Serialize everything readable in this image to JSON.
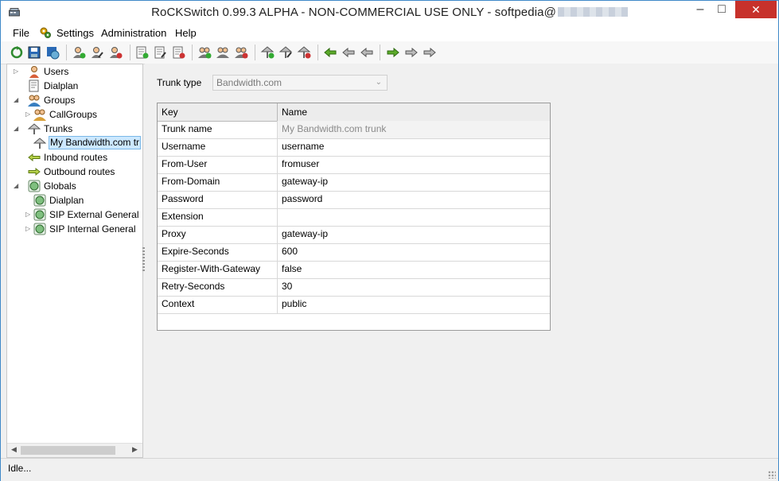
{
  "window": {
    "title": "RoCKSwitch 0.99.3 ALPHA - NON-COMMERCIAL USE ONLY - softpedia@"
  },
  "menu": [
    "File",
    "Settings",
    "Administration",
    "Help"
  ],
  "tree": {
    "items": [
      {
        "label": "Users",
        "icon": "user-icon"
      },
      {
        "label": "Dialplan",
        "icon": "dialplan-icon"
      },
      {
        "label": "Groups",
        "icon": "group-icon"
      },
      {
        "label": "CallGroups",
        "icon": "group-icon"
      },
      {
        "label": "Trunks",
        "icon": "trunk-icon"
      },
      {
        "label": "My Bandwidth.com tr",
        "icon": "trunk-icon"
      },
      {
        "label": "Inbound routes",
        "icon": "arrow-left-icon"
      },
      {
        "label": "Outbound routes",
        "icon": "arrow-right-icon"
      },
      {
        "label": "Globals",
        "icon": "globe-icon"
      },
      {
        "label": "Dialplan",
        "icon": "globe-icon"
      },
      {
        "label": "SIP External General",
        "icon": "globe-icon"
      },
      {
        "label": "SIP Internal General",
        "icon": "globe-icon"
      }
    ]
  },
  "form": {
    "trunk_type_label": "Trunk type",
    "trunk_type_value": "Bandwidth.com"
  },
  "table": {
    "columns": [
      "Key",
      "Name"
    ],
    "rows": [
      {
        "key": "Trunk name",
        "value": "My Bandwidth.com trunk"
      },
      {
        "key": "Username",
        "value": "username"
      },
      {
        "key": "From-User",
        "value": "fromuser"
      },
      {
        "key": "From-Domain",
        "value": "gateway-ip"
      },
      {
        "key": "Password",
        "value": "password"
      },
      {
        "key": "Extension",
        "value": ""
      },
      {
        "key": "Proxy",
        "value": "gateway-ip"
      },
      {
        "key": "Expire-Seconds",
        "value": "600"
      },
      {
        "key": "Register-With-Gateway",
        "value": "false"
      },
      {
        "key": "Retry-Seconds",
        "value": "30"
      },
      {
        "key": "Context",
        "value": "public"
      }
    ]
  },
  "status": {
    "text": "Idle..."
  }
}
